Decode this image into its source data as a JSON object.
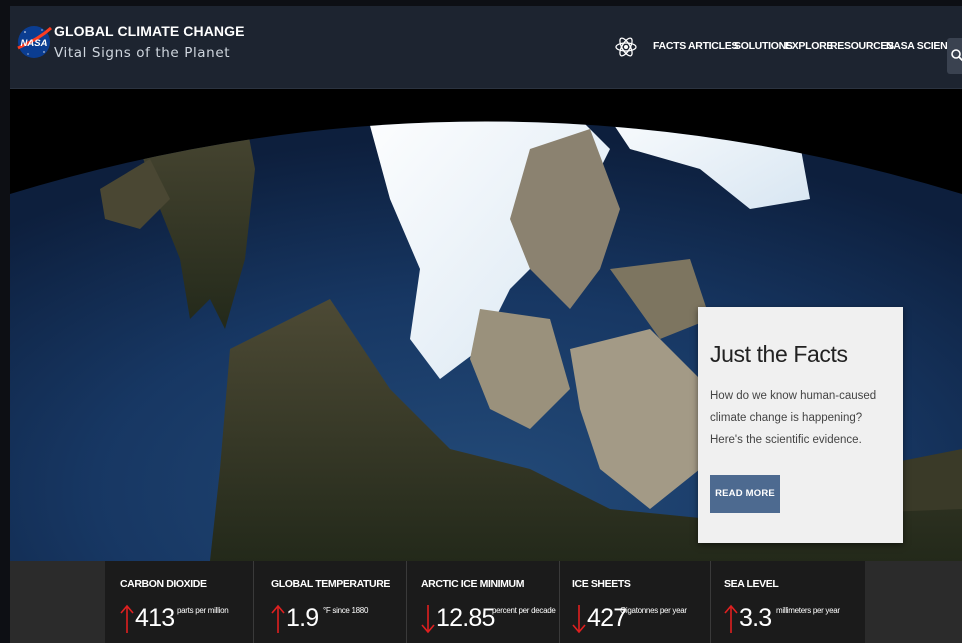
{
  "header": {
    "logo_text": "NASA",
    "title": "GLOBAL CLIMATE CHANGE",
    "subtitle": "Vital Signs of the Planet"
  },
  "nav": {
    "items": [
      {
        "label": "FACTS"
      },
      {
        "label": "ARTICLES"
      },
      {
        "label": "SOLUTIONS"
      },
      {
        "label": "EXPLORE"
      },
      {
        "label": "RESOURCES"
      },
      {
        "label": "NASA SCIENCE"
      }
    ],
    "search_icon": "search-icon"
  },
  "hero": {
    "card": {
      "title": "Just the Facts",
      "body": "How do we know human-caused climate change is happening? Here's the scientific evidence.",
      "button_label": "READ MORE"
    }
  },
  "vitals": [
    {
      "label": "CARBON DIOXIDE",
      "value": "413",
      "unit": "parts per million",
      "trend": "up"
    },
    {
      "label": "GLOBAL TEMPERATURE",
      "value": "1.9",
      "unit": "°F since 1880",
      "trend": "up"
    },
    {
      "label": "ARCTIC ICE MINIMUM",
      "value": "12.85",
      "unit": "percent per decade",
      "trend": "down"
    },
    {
      "label": "ICE SHEETS",
      "value": "427",
      "unit": "Gigatonnes per year",
      "trend": "down"
    },
    {
      "label": "SEA LEVEL",
      "value": "3.3",
      "unit": "millimeters per year",
      "trend": "up"
    }
  ],
  "colors": {
    "header_bg": "#1d2430",
    "trend_arrow": "#e02020",
    "button": "#4d6a90",
    "card_bg": "#f0f0f0"
  }
}
